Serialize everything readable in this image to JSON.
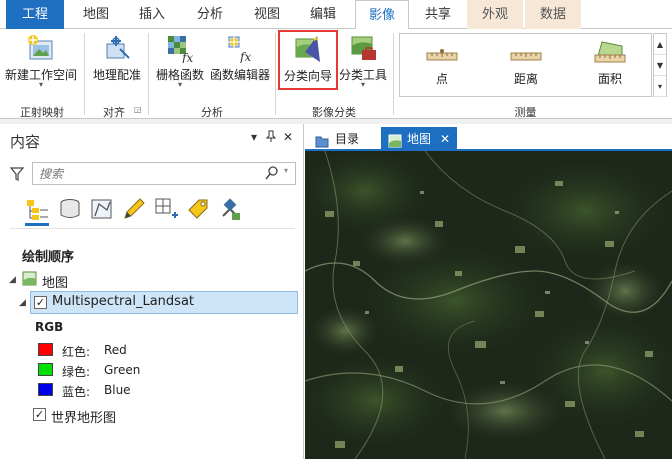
{
  "ribbon_tabs": [
    "工程",
    "地图",
    "插入",
    "分析",
    "视图",
    "编辑",
    "影像",
    "共享",
    "外观",
    "数据"
  ],
  "ribbon": {
    "temporal": {
      "new_workspace": "新建工作空间",
      "group": "正射映射"
    },
    "align": {
      "georef": "地理配准",
      "group": "对齐"
    },
    "analysis": {
      "raster_functions": "栅格函数",
      "function_editor": "函数编辑器",
      "group": "分析"
    },
    "classification": {
      "wizard": "分类向导",
      "tools": "分类工具",
      "group": "影像分类"
    },
    "measure": {
      "point": "点",
      "distance": "距离",
      "area": "面积",
      "group": "测量"
    }
  },
  "contents": {
    "title": "内容",
    "pin": "ᵖ",
    "search_placeholder": "搜索",
    "draw_order": "绘制顺序",
    "map_name": "地图",
    "layer_name": "Multispectral_Landsat",
    "renderer": "RGB",
    "bands": [
      {
        "label": "红色:",
        "name": "Red",
        "color": "#ff0000"
      },
      {
        "label": "绿色:",
        "name": "Green",
        "color": "#00e000"
      },
      {
        "label": "蓝色:",
        "name": "Blue",
        "color": "#0000e6"
      }
    ],
    "basemap": "世界地形图"
  },
  "view_tabs": {
    "catalog": "目录",
    "map": "地图"
  },
  "colors": {
    "accent": "#1e6fc1",
    "highlight": "#cde5f7",
    "selected_border": "#e53935"
  }
}
